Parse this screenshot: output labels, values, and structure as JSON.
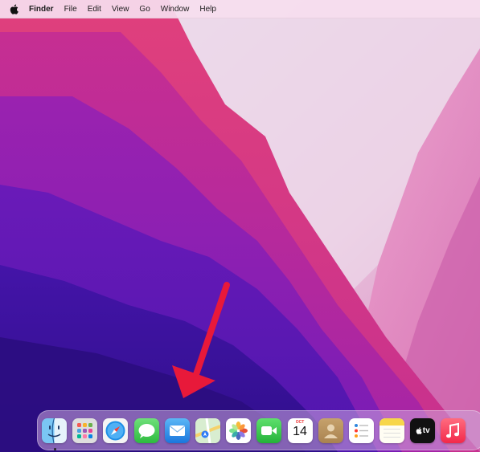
{
  "menubar": {
    "apple_icon": "apple-logo-icon",
    "app_name": "Finder",
    "items": [
      "File",
      "Edit",
      "View",
      "Go",
      "Window",
      "Help"
    ]
  },
  "dock": {
    "apps": [
      {
        "name": "Finder",
        "icon": "finder-icon",
        "running": true
      },
      {
        "name": "Launchpad",
        "icon": "launchpad-icon"
      },
      {
        "name": "Safari",
        "icon": "safari-icon"
      },
      {
        "name": "Messages",
        "icon": "messages-icon"
      },
      {
        "name": "Mail",
        "icon": "mail-icon"
      },
      {
        "name": "Maps",
        "icon": "maps-icon"
      },
      {
        "name": "Photos",
        "icon": "photos-icon"
      },
      {
        "name": "FaceTime",
        "icon": "facetime-icon"
      },
      {
        "name": "Calendar",
        "icon": "calendar-icon",
        "month": "OCT",
        "day": "14"
      },
      {
        "name": "Contacts",
        "icon": "contacts-icon"
      },
      {
        "name": "Reminders",
        "icon": "reminders-icon"
      },
      {
        "name": "Notes",
        "icon": "notes-icon"
      },
      {
        "name": "TV",
        "icon": "apple-tv-icon",
        "label": "tv"
      },
      {
        "name": "Music",
        "icon": "music-icon"
      }
    ]
  },
  "colors": {
    "annotation_arrow": "#e8193a",
    "wallpaper_dark": "#3a1296",
    "wallpaper_pink": "#d83a9a"
  }
}
